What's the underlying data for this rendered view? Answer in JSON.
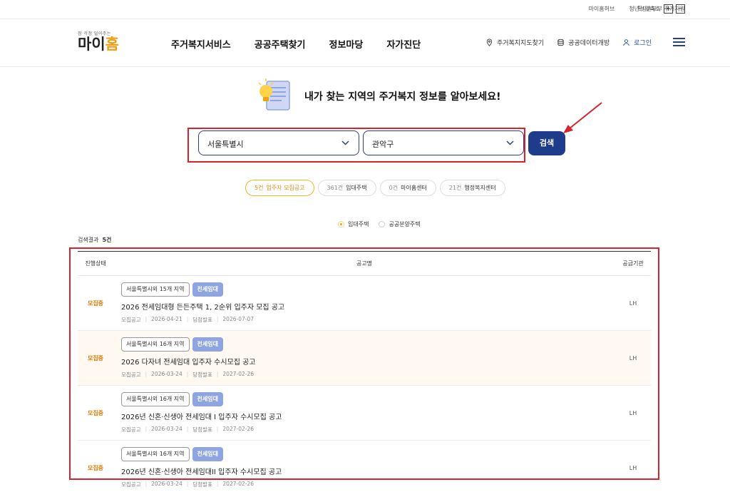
{
  "util": {
    "link1": "마이홈허브",
    "link2": "청년·신혼부부 주거지원",
    "zoom_label": "확대/축소",
    "zoom_in": "+",
    "zoom_out": "−"
  },
  "header": {
    "logo_sub": "집 걱정 덜어주는",
    "logo_main_a": "마이",
    "logo_main_b": "홈",
    "nav": [
      "주거복지서비스",
      "공공주택찾기",
      "정보마당",
      "자가진단"
    ],
    "map_link": "주거복지지도찾기",
    "data_link": "공공데이터개방",
    "login": "로그인"
  },
  "hero": {
    "title": "내가 찾는 지역의 주거복지 정보를 알아보세요!"
  },
  "search": {
    "city": "서울특별시",
    "district": "관악구",
    "button": "검색"
  },
  "tabs": [
    {
      "count": "5건",
      "label": "입주자 모집공고",
      "active": true
    },
    {
      "count": "361건",
      "label": "임대주택",
      "active": false
    },
    {
      "count": "0건",
      "label": "마이홈센터",
      "active": false
    },
    {
      "count": "21건",
      "label": "행정복지센터",
      "active": false
    }
  ],
  "radios": {
    "opt1": "임대주택",
    "opt2": "공공분양주택"
  },
  "results": {
    "label": "검색결과",
    "count": "5건"
  },
  "table": {
    "headers": {
      "status": "진행상태",
      "title": "공고명",
      "org": "공급기관"
    },
    "rows": [
      {
        "status": "모집중",
        "region": "서울특별시외 15개 지역",
        "type": "전세임대",
        "title": "2026 전세임대형 든든주택 1, 2순위 입주자 모집 공고",
        "label1": "모집공고",
        "date1": "2026-04-21",
        "label2": "당첨발표",
        "date2": "2026-07-07",
        "org": "LH"
      },
      {
        "status": "모집중",
        "region": "서울특별시외 16개 지역",
        "type": "전세임대",
        "title": "2026 다자녀 전세임대 입주자 수시모집 공고",
        "label1": "모집공고",
        "date1": "2026-03-24",
        "label2": "당첨발표",
        "date2": "2027-02-26",
        "org": "LH"
      },
      {
        "status": "모집중",
        "region": "서울특별시외 16개 지역",
        "type": "전세임대",
        "title": "2026년 신혼·신생아 전세임대 I 입주자 수시모집 공고",
        "label1": "모집공고",
        "date1": "2026-03-24",
        "label2": "당첨발표",
        "date2": "2027-02-26",
        "org": "LH"
      },
      {
        "status": "모집중",
        "region": "서울특별시외 16개 지역",
        "type": "전세임대",
        "title": "2026년 신혼·신생아 전세임대II 입주자 수시모집 공고",
        "label1": "모집공고",
        "date1": "2026-03-24",
        "label2": "당첨발표",
        "date2": "2027-02-26",
        "org": "LH"
      }
    ]
  },
  "colors": {
    "brand_navy": "#1f3c8c",
    "accent_orange": "#f39c12",
    "highlight_red": "#d8232a"
  }
}
